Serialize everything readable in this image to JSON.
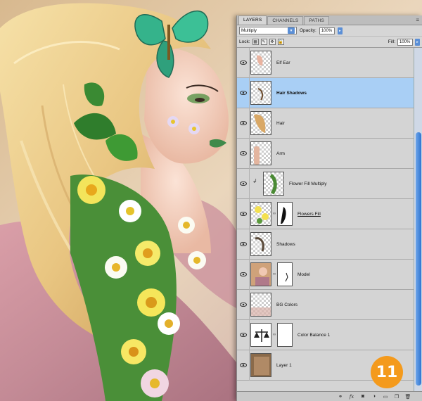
{
  "panel": {
    "tabs": [
      "LAYERS",
      "CHANNELS",
      "PATHS"
    ],
    "active_tab": "LAYERS",
    "blend_mode": "Multiply",
    "opacity_label": "Opacity:",
    "opacity_value": "100%",
    "lock_label": "Lock:",
    "fill_label": "Fill:",
    "fill_value": "100%"
  },
  "layers": [
    {
      "name": "Elf Ear",
      "selected": false
    },
    {
      "name": "Hair Shadows",
      "selected": true
    },
    {
      "name": "Hair",
      "selected": false
    },
    {
      "name": "Arm",
      "selected": false
    },
    {
      "name": "Flower Fill Multiply",
      "selected": false,
      "clipped": true
    },
    {
      "name": "Flowers Fill",
      "selected": false,
      "has_mask": true
    },
    {
      "name": "Shadows",
      "selected": false
    },
    {
      "name": "Model",
      "selected": false,
      "has_mask": true
    },
    {
      "name": "BG Colors",
      "selected": false
    },
    {
      "name": "Color Balance 1",
      "selected": false,
      "adjustment": true
    },
    {
      "name": "Layer 1",
      "selected": false
    }
  ],
  "footer_icons": [
    "link-icon",
    "fx-icon",
    "mask-icon",
    "adjustment-icon",
    "folder-icon",
    "new-layer-icon",
    "trash-icon"
  ],
  "badge": {
    "text": "11",
    "color": "#f49a1c"
  },
  "colors": {
    "selection": "#a9cff5",
    "panel": "#d6d6d6",
    "accent": "#5b8fd6"
  }
}
